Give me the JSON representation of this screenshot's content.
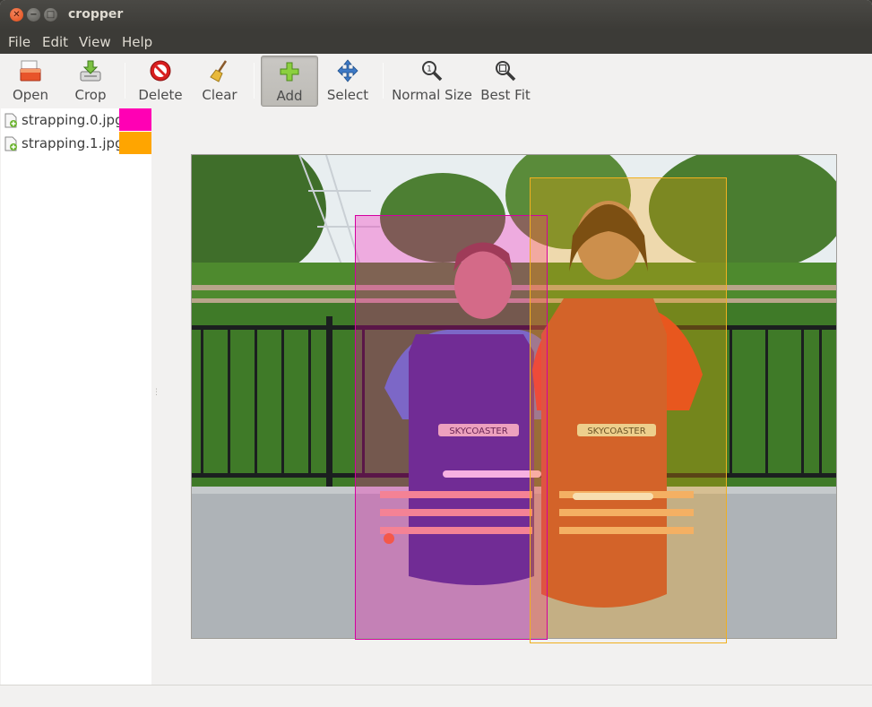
{
  "window": {
    "title": "cropper",
    "close_glyph": "✕",
    "minimize_glyph": "−",
    "maximize_glyph": "□"
  },
  "menubar": {
    "items": [
      "File",
      "Edit",
      "View",
      "Help"
    ]
  },
  "toolbar": {
    "open": {
      "label": "Open",
      "icon": "open-folder-icon"
    },
    "crop": {
      "label": "Crop",
      "icon": "crop-download-icon"
    },
    "delete": {
      "label": "Delete",
      "icon": "delete-no-entry-icon"
    },
    "clear": {
      "label": "Clear",
      "icon": "broom-icon"
    },
    "add": {
      "label": "Add",
      "icon": "plus-icon",
      "active": true
    },
    "select": {
      "label": "Select",
      "icon": "move-arrows-icon"
    },
    "normal_size": {
      "label": "Normal Size",
      "icon": "zoom-original-icon"
    },
    "best_fit": {
      "label": "Best Fit",
      "icon": "zoom-fit-icon"
    }
  },
  "sidebar": {
    "files": [
      {
        "name": "strapping.0.jpg",
        "color": "#ff00b4",
        "icon": "image-add-icon"
      },
      {
        "name": "strapping.1.jpg",
        "color": "#ffa500",
        "icon": "image-add-icon"
      }
    ]
  },
  "canvas": {
    "image_description_icon": "photo",
    "regions": [
      {
        "file": "strapping.0.jpg",
        "color": "#ff00b4"
      },
      {
        "file": "strapping.1.jpg",
        "color": "#ffa500"
      }
    ],
    "sign_text": "SKYCOASTER"
  },
  "colors": {
    "title_bar": "#3c3b37",
    "close_button": "#df4a16",
    "window_bg": "#f2f1f0"
  }
}
